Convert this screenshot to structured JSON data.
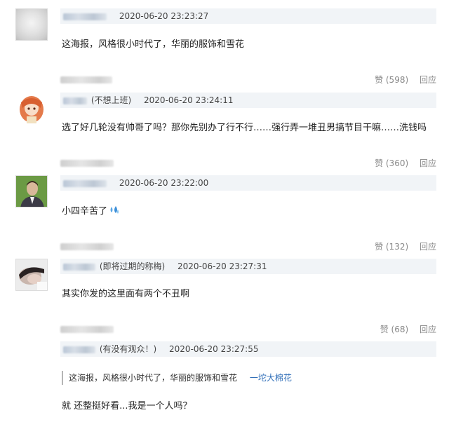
{
  "comments": [
    {
      "suffix": "",
      "time": "2020-06-20 23:23:27",
      "text": "这海报，风格很小时代了，华丽的服饰和雪花",
      "like_label": "赞 (598)",
      "reply_label": "回应"
    },
    {
      "suffix": "(不想上班)",
      "time": "2020-06-20 23:24:11",
      "text": "选了好几轮没有帅哥了吗？那你先别办了行不行……强行弄一堆丑男搞节目干嘛……洗钱吗",
      "like_label": "赞 (360)",
      "reply_label": "回应"
    },
    {
      "suffix": "",
      "time": "2020-06-20 23:22:00",
      "text": "小四辛苦了",
      "emoji": "sweat-drops-icon",
      "like_label": "赞 (132)",
      "reply_label": "回应"
    },
    {
      "suffix": "(即将过期的称梅)",
      "time": "2020-06-20 23:27:31",
      "text": "其实你发的这里面有两个不丑啊",
      "like_label": "赞 (68)",
      "reply_label": "回应"
    },
    {
      "suffix": "(有没有观众！)",
      "time": "2020-06-20 23:27:55",
      "quote_text": "这海报，风格很小时代了，华丽的服饰和雪花",
      "quote_author": "一坨大棉花",
      "text": "就 还整挺好看...我是一个人吗？"
    }
  ],
  "colors": {
    "meta_bar": "#f1f4f7",
    "link": "#2f6eb8"
  }
}
